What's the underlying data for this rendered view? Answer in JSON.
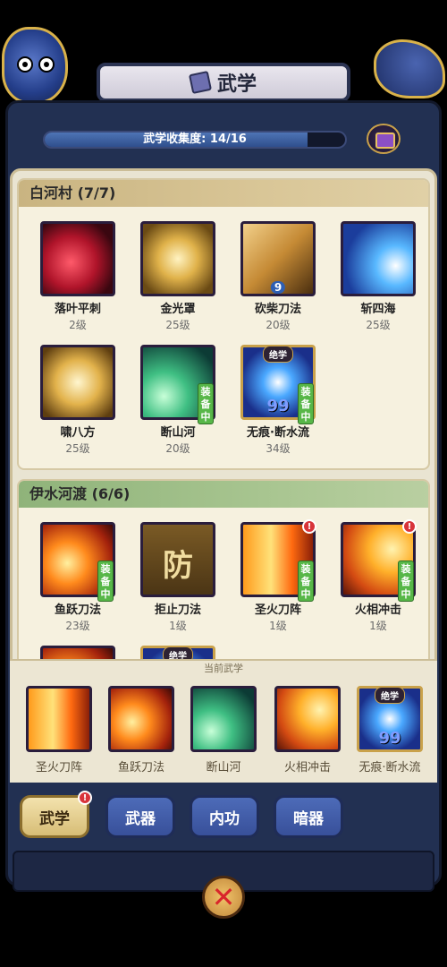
{
  "title": "武学",
  "collection": {
    "label": "武学收集度: 14/16",
    "collected": 14,
    "total": 16
  },
  "sections": [
    {
      "name": "白河村 (7/7)",
      "skills": [
        {
          "name": "落叶平刺",
          "level": "2级",
          "art": "crimson-slash"
        },
        {
          "name": "金光罩",
          "level": "25级",
          "art": "golden-shield"
        },
        {
          "name": "砍柴刀法",
          "level": "20级",
          "art": "blade-hand",
          "badge": "9"
        },
        {
          "name": "斩四海",
          "level": "25级",
          "art": "blue-wave"
        },
        {
          "name": "啸八方",
          "level": "25级",
          "art": "gold-swirl"
        },
        {
          "name": "断山河",
          "level": "20级",
          "art": "green-arc",
          "equipped": "装备中"
        },
        {
          "name": "无痕·断水流",
          "level": "34级",
          "art": "blue-orb",
          "ultimate": "绝学",
          "equipped": "装备中",
          "number": "99"
        }
      ]
    },
    {
      "name": "伊水河渡 (6/6)",
      "skills": [
        {
          "name": "鱼跃刀法",
          "level": "23级",
          "art": "fire-orb",
          "equipped": "装备中"
        },
        {
          "name": "拒止刀法",
          "level": "1级",
          "art": "defense",
          "glyph": "防"
        },
        {
          "name": "圣火刀阵",
          "level": "1级",
          "art": "fire-blades",
          "equipped": "装备中",
          "alert": "!"
        },
        {
          "name": "火相冲击",
          "level": "1级",
          "art": "fire-sweep",
          "equipped": "装备中",
          "alert": "!"
        }
      ],
      "partial_ultimate": "绝学"
    }
  ],
  "current_label": "当前武学",
  "current_skills": [
    {
      "name": "圣火刀阵",
      "art": "fire-blades"
    },
    {
      "name": "鱼跃刀法",
      "art": "fire-orb"
    },
    {
      "name": "断山河",
      "art": "green-arc"
    },
    {
      "name": "火相冲击",
      "art": "fire-sweep"
    },
    {
      "name": "无痕·断水流",
      "art": "blue-orb",
      "ultimate": "绝学",
      "number": "99"
    }
  ],
  "tabs": [
    {
      "label": "武学",
      "active": true,
      "alert": "!"
    },
    {
      "label": "武器",
      "active": false
    },
    {
      "label": "内功",
      "active": false
    },
    {
      "label": "暗器",
      "active": false
    }
  ],
  "colors": {
    "panel": "#e9e4d2",
    "frame": "#223052",
    "accent_gold": "#c9a14a",
    "equip_green": "#57b748",
    "alert_red": "#d8343a"
  }
}
